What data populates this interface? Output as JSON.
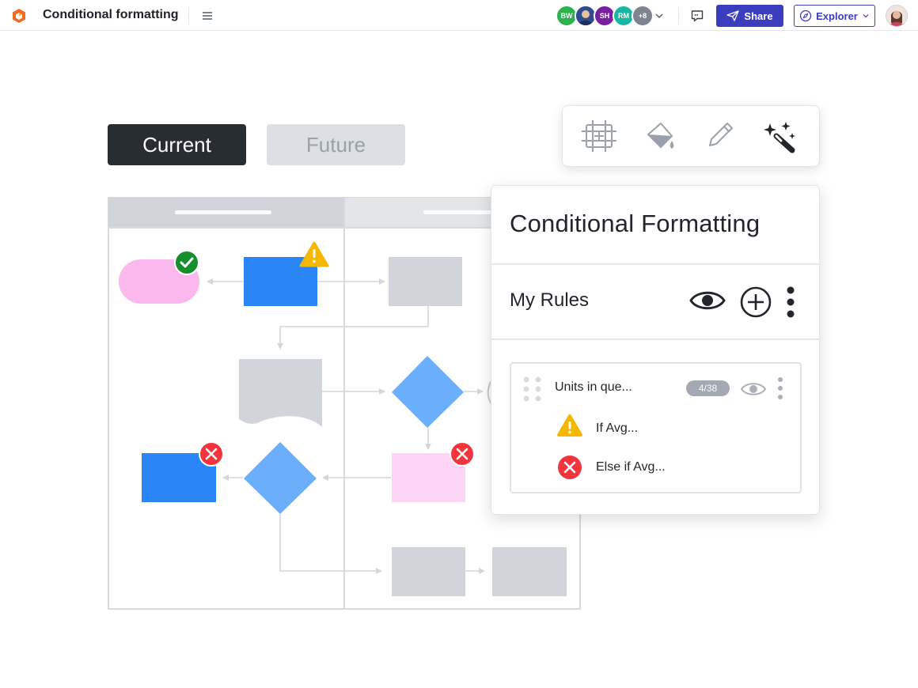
{
  "app": {
    "document_title": "Conditional formatting"
  },
  "collaborators": {
    "avatars": [
      {
        "initials": "BW",
        "color": "#2bb24c"
      },
      {
        "initials": "",
        "color": "#3a5fb0"
      },
      {
        "initials": "SH",
        "color": "#7a1fa2"
      },
      {
        "initials": "RM",
        "color": "#18b7a3"
      },
      {
        "initials": "+8",
        "color": "#7c8490"
      }
    ]
  },
  "toolbar": {
    "share_label": "Share",
    "explorer_label": "Explorer"
  },
  "tabs": {
    "current": "Current",
    "future": "Future"
  },
  "panel": {
    "title": "Conditional Formatting",
    "rules_title": "My Rules",
    "rule": {
      "name": "Units in que...",
      "count": "4/38",
      "conditions": [
        {
          "icon": "warning-icon",
          "text": "If Avg..."
        },
        {
          "icon": "error-icon",
          "text": "Else if Avg..."
        }
      ]
    }
  },
  "tools": [
    "select-frame-icon",
    "paint-bucket-icon",
    "pencil-icon",
    "magic-wand-icon"
  ],
  "colors": {
    "accent": "#3b3dbf",
    "tab_dark": "#282c33",
    "shape_blue": "#2a86f6",
    "diamond_blue": "#6aaefc",
    "shape_pink": "#fed4f5",
    "shape_gray": "#d1d5db",
    "success": "#148f2c",
    "warning": "#f5b800",
    "error": "#f2353c"
  }
}
